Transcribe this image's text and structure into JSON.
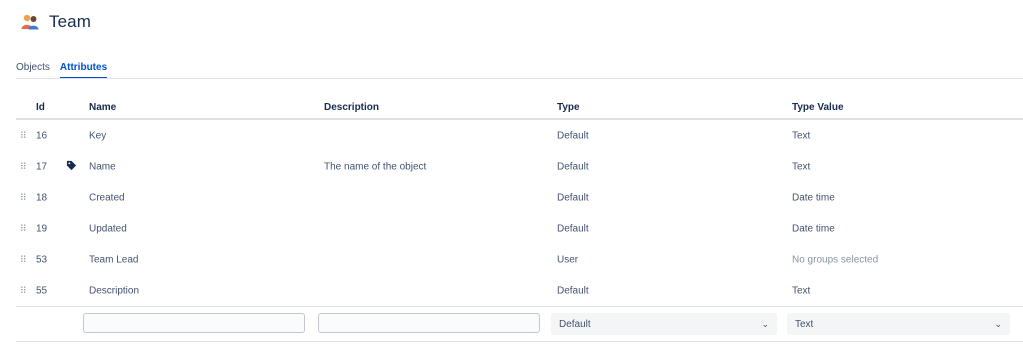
{
  "header": {
    "title": "Team",
    "icon": "team-icon"
  },
  "tabs": [
    {
      "label": "Objects",
      "active": false
    },
    {
      "label": "Attributes",
      "active": true
    }
  ],
  "table": {
    "columns": {
      "id": "Id",
      "name": "Name",
      "description": "Description",
      "type": "Type",
      "type_value": "Type Value"
    },
    "rows": [
      {
        "id": "16",
        "name": "Key",
        "description": "",
        "type": "Default",
        "type_value": "Text",
        "label_icon": false
      },
      {
        "id": "17",
        "name": "Name",
        "description": "The name of the object",
        "type": "Default",
        "type_value": "Text",
        "label_icon": true
      },
      {
        "id": "18",
        "name": "Created",
        "description": "",
        "type": "Default",
        "type_value": "Date time",
        "label_icon": false
      },
      {
        "id": "19",
        "name": "Updated",
        "description": "",
        "type": "Default",
        "type_value": "Date time",
        "label_icon": false
      },
      {
        "id": "53",
        "name": "Team Lead",
        "description": "",
        "type": "User",
        "type_value": "No groups selected",
        "label_icon": false
      },
      {
        "id": "55",
        "name": "Description",
        "description": "",
        "type": "Default",
        "type_value": "Text",
        "label_icon": false
      }
    ]
  },
  "new_row": {
    "name_value": "",
    "description_value": "",
    "type_selected": "Default",
    "type_value_selected": "Text"
  },
  "icons": {
    "drag": "drag-handle-icon",
    "label": "tag-icon",
    "chevron": "chevron-down-icon"
  },
  "colors": {
    "accent": "#0052cc",
    "text": "#172b4d",
    "muted": "#8993a4",
    "border": "#dfe1e6"
  }
}
